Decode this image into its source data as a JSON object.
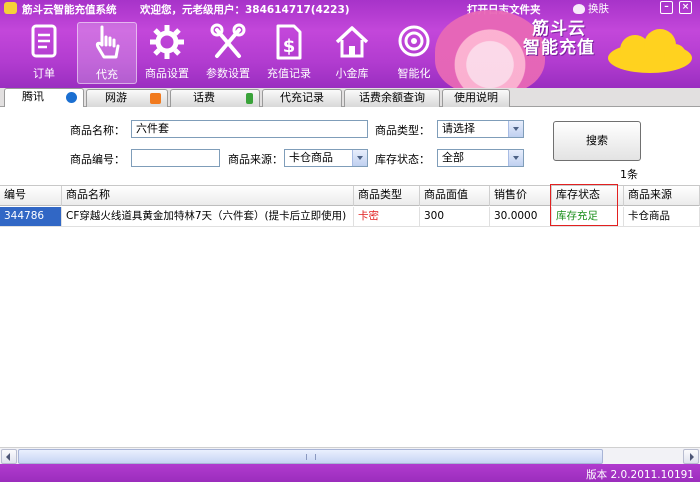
{
  "header": {
    "app_title": "筋斗云智能充值系统",
    "welcome": "欢迎您，元老级用户：384614717(4223)",
    "open_log_folder": "打开日志文件夹",
    "skin_label": "换肤",
    "brand_line1": "筋斗云",
    "brand_line2": "智能充值",
    "minimize_symbol": "–",
    "close_symbol": "×"
  },
  "toolbar": [
    {
      "label": "订单",
      "icon": "order-icon"
    },
    {
      "label": "代充",
      "icon": "hand-pointer-icon"
    },
    {
      "label": "商品设置",
      "icon": "gear-icon"
    },
    {
      "label": "参数设置",
      "icon": "tools-icon"
    },
    {
      "label": "充值记录",
      "icon": "dollar-doc-icon"
    },
    {
      "label": "小金库",
      "icon": "home-icon"
    },
    {
      "label": "智能化",
      "icon": "target-icon"
    }
  ],
  "tabs": [
    {
      "label": "腾讯",
      "icon_color": "#1b6fd1"
    },
    {
      "label": "网游",
      "icon_color": "#f17a1e"
    },
    {
      "label": "话费",
      "icon_color": "#3aa33a"
    },
    {
      "label": "代充记录",
      "icon_color": ""
    },
    {
      "label": "话费余额查询",
      "icon_color": ""
    },
    {
      "label": "使用说明",
      "icon_color": ""
    }
  ],
  "search": {
    "name_label": "商品名称：",
    "name_value": "六件套",
    "type_label": "商品类型：",
    "type_value": "请选择",
    "id_label": "商品编号：",
    "id_value": "",
    "source_label": "商品来源：",
    "source_value": "卡仓商品",
    "stock_label": "库存状态：",
    "stock_value": "全部",
    "search_button": "搜索",
    "result_count": "1条"
  },
  "grid": {
    "columns": [
      "编号",
      "商品名称",
      "商品类型",
      "商品面值",
      "销售价",
      "库存状态",
      "商品来源"
    ],
    "rows": [
      {
        "id": "344786",
        "name": "CF穿越火线道具黄金加特林7天（六件套）(提卡后立即使用)",
        "type": "卡密",
        "face_value": "300",
        "price": "30.0000",
        "stock": "库存充足",
        "source": "卡仓商品"
      }
    ],
    "type_color": "#e01c1c",
    "stock_color": "#1b8f1b"
  },
  "status": {
    "version": "版本 2.0.2011.10191"
  }
}
